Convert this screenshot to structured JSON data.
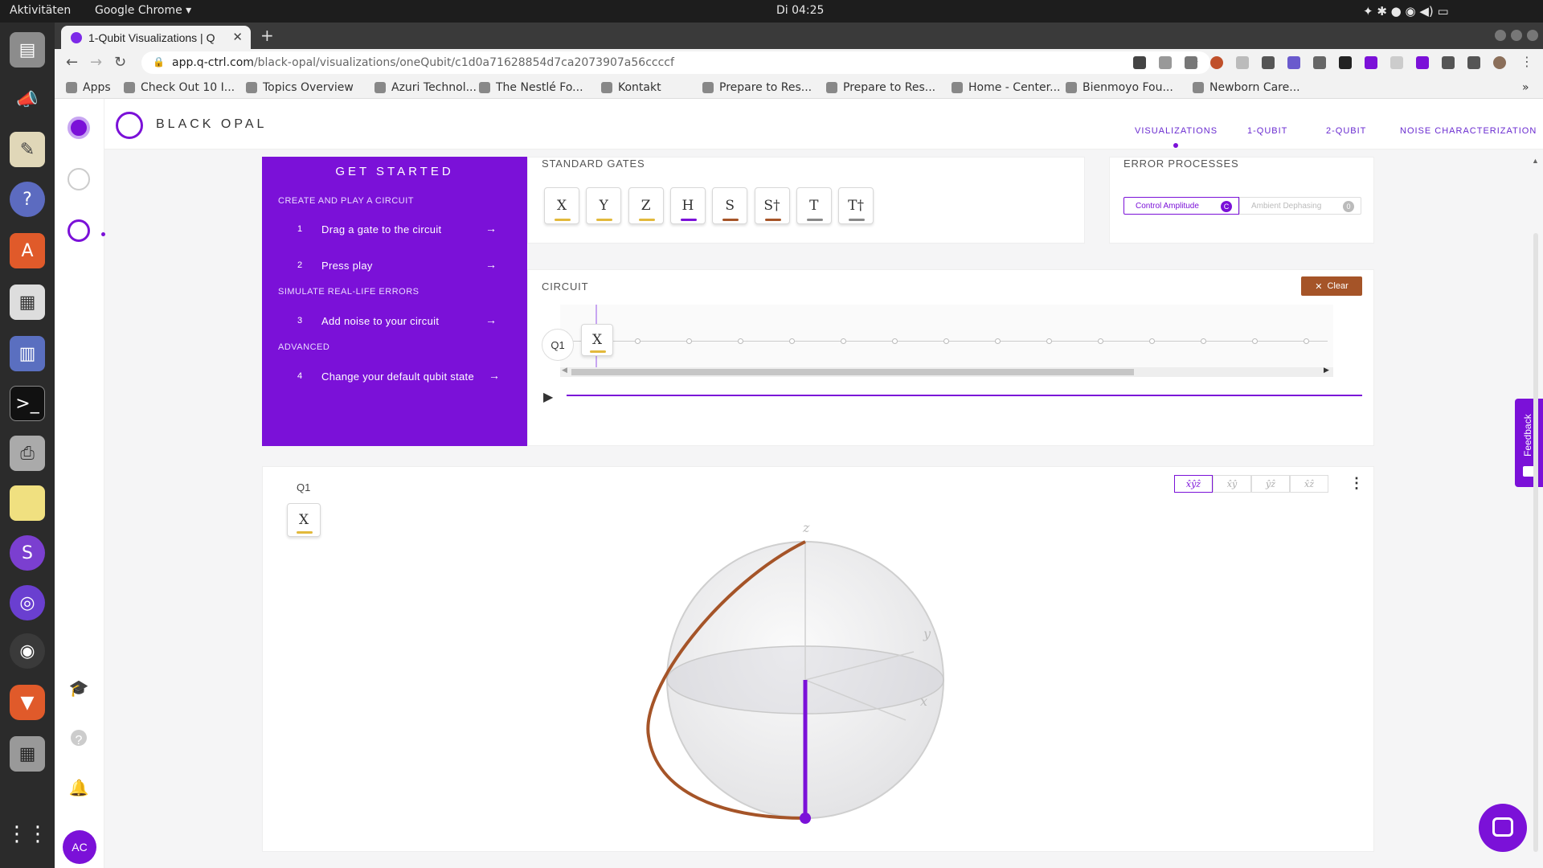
{
  "os": {
    "activities": "Aktivitäten",
    "app_menu": "Google Chrome",
    "clock": "Di 04:25",
    "dock_user_initials": "AC"
  },
  "browser": {
    "tab_title": "1-Qubit Visualizations | Q",
    "url_domain": "app.q-ctrl.com",
    "url_path": "/black-opal/visualizations/oneQubit/c1d0a71628854d7ca2073907a56ccccf",
    "bookmarks": [
      "Apps",
      "Check Out 10 I...",
      "Topics Overview",
      "Azuri Technol...",
      "The Nestlé Fo...",
      "Kontakt",
      "Prepare to Res...",
      "Prepare to Res...",
      "Home - Center...",
      "Bienmoyo Fou...",
      "Newborn Care..."
    ]
  },
  "app": {
    "brand": "BLACK OPAL",
    "nav": [
      "VISUALIZATIONS",
      "1-QUBIT",
      "2-QUBIT",
      "NOISE CHARACTERIZATION"
    ],
    "get_started": {
      "title": "GET STARTED",
      "sections": [
        {
          "heading": "CREATE AND PLAY A CIRCUIT",
          "steps": [
            {
              "num": "1",
              "label": "Drag a gate to the circuit"
            },
            {
              "num": "2",
              "label": "Press play"
            }
          ]
        },
        {
          "heading": "SIMULATE REAL-LIFE ERRORS",
          "steps": [
            {
              "num": "3",
              "label": "Add noise to your circuit"
            }
          ]
        },
        {
          "heading": "ADVANCED",
          "steps": [
            {
              "num": "4",
              "label": "Change your default qubit state"
            }
          ]
        }
      ]
    },
    "standard_gates": {
      "label": "STANDARD GATES",
      "gates": [
        {
          "symbol": "X",
          "color": "#e2b93b"
        },
        {
          "symbol": "Y",
          "color": "#e2b93b"
        },
        {
          "symbol": "Z",
          "color": "#e2b93b"
        },
        {
          "symbol": "H",
          "color": "#7b11d8"
        },
        {
          "symbol": "S",
          "color": "#a55428"
        },
        {
          "symbol": "S†",
          "color": "#a55428"
        },
        {
          "symbol": "T",
          "color": "#888888"
        },
        {
          "symbol": "T†",
          "color": "#888888"
        }
      ]
    },
    "error_processes": {
      "label": "ERROR PROCESSES",
      "options": [
        {
          "label": "Control Amplitude",
          "value": "C",
          "active": true
        },
        {
          "label": "Ambient Dephasing",
          "value": "0",
          "active": false
        }
      ]
    },
    "circuit": {
      "label": "CIRCUIT",
      "clear_label": "Clear",
      "qubit": "Q1",
      "placed_gate": "X",
      "slots": 14
    },
    "bloch": {
      "qubit": "Q1",
      "gate": "X",
      "view_buttons": [
        "x̂ŷẑ",
        "x̂ŷ",
        "ŷẑ",
        "x̂ẑ"
      ],
      "active_view": 0,
      "axis_labels": {
        "z": "z",
        "y": "y",
        "x": "x"
      }
    },
    "feedback_label": "Feedback"
  },
  "colors": {
    "accent": "#7b11d8",
    "clear_button": "#a55428",
    "trajectory": "#a55428"
  }
}
